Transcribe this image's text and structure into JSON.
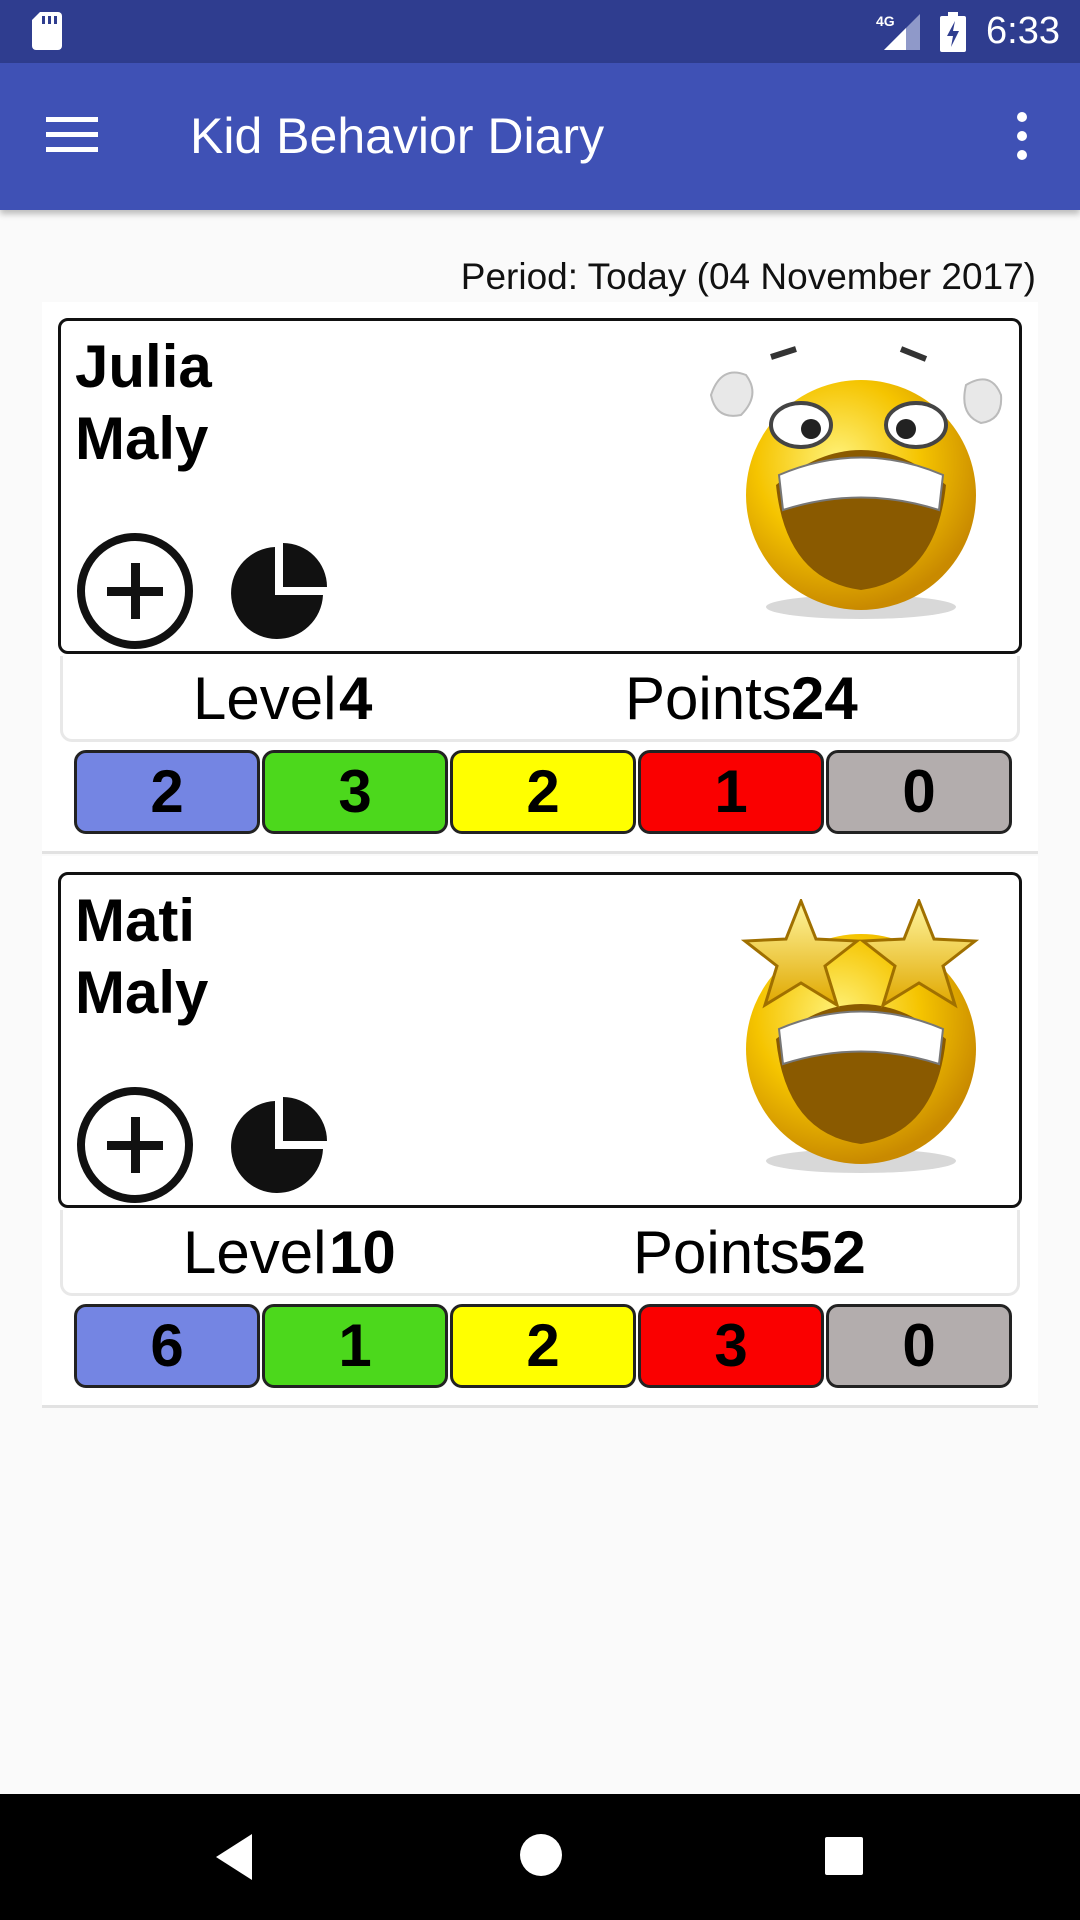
{
  "status_bar": {
    "time": "6:33",
    "network": "4G",
    "icons": [
      "sd-card-icon",
      "signal-icon",
      "battery-charging-icon"
    ]
  },
  "app_bar": {
    "title": "Kid Behavior Diary",
    "icons": [
      "menu-icon",
      "overflow-menu-icon"
    ]
  },
  "period": "Period: Today (04 November 2017)",
  "counter_colors": [
    "#7485e3",
    "#4cd81c",
    "#ffff00",
    "#fa0000",
    "#b3adad"
  ],
  "kids": [
    {
      "first_name": "Julia",
      "last_name": "Maly",
      "level_label": "Level",
      "level": "4",
      "points_label": "Points",
      "points": "24",
      "mood_icon": "laughing-emoji-icon",
      "counters": [
        "2",
        "3",
        "2",
        "1",
        "0"
      ]
    },
    {
      "first_name": "Mati",
      "last_name": "Maly",
      "level_label": "Level",
      "level": "10",
      "points_label": "Points",
      "points": "52",
      "mood_icon": "star-eyes-emoji-icon",
      "counters": [
        "6",
        "1",
        "2",
        "3",
        "0"
      ]
    }
  ]
}
